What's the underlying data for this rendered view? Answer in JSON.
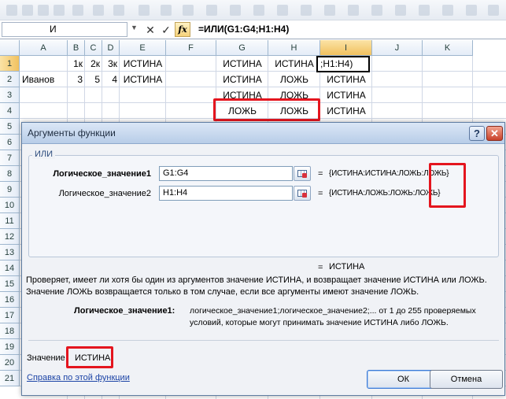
{
  "formula_bar": {
    "name_box": "И",
    "name_box_arrow": "▼",
    "cancel_glyph": "✕",
    "enter_glyph": "✓",
    "fx_label": "fx",
    "formula": "=ИЛИ(G1:G4;H1:H4)"
  },
  "grid": {
    "columns": [
      "A",
      "B",
      "C",
      "D",
      "E",
      "F",
      "G",
      "H",
      "I",
      "J",
      "K"
    ],
    "rows": [
      "1",
      "2",
      "3",
      "4",
      "5",
      "6",
      "7",
      "8",
      "9",
      "10",
      "11",
      "12",
      "13",
      "14",
      "15",
      "16",
      "17",
      "18",
      "19",
      "20",
      "21"
    ],
    "cells": {
      "B1": "1к",
      "C1": "2к",
      "D1": "3к",
      "E1": "ИСТИНА",
      "G1": "ИСТИНА",
      "H1": "ИСТИНА",
      "I1": ";H1:H4)",
      "A2": "Иванов",
      "B2": "3",
      "C2": "5",
      "D2": "4",
      "E2": "ИСТИНА",
      "G2": "ИСТИНА",
      "H2": "ЛОЖЬ",
      "I2": "ИСТИНА",
      "G3": "ИСТИНА",
      "H3": "ЛОЖЬ",
      "I3": "ИСТИНА",
      "G4": "ЛОЖЬ",
      "H4": "ЛОЖЬ",
      "I4": "ИСТИНА"
    }
  },
  "dialog": {
    "title": "Аргументы функции",
    "help_glyph": "?",
    "close_glyph": "✕",
    "function_name": "ИЛИ",
    "args": [
      {
        "label": "Логическое_значение1",
        "value": "G1:G4",
        "result": "{ИСТИНА:ИСТИНА:ЛОЖЬ:ЛОЖЬ}"
      },
      {
        "label": "Логическое_значение2",
        "value": "H1:H4",
        "result": "{ИСТИНА:ЛОЖЬ:ЛОЖЬ:ЛОЖЬ}"
      }
    ],
    "equals": "=",
    "result_line": "ИСТИНА",
    "description": [
      "Проверяет, имеет ли хотя бы один из аргументов значение ИСТИНА, и возвращает значение ИСТИНА или ЛОЖЬ.",
      "Значение ЛОЖЬ возвращается только в том случае, если все аргументы имеют значение ЛОЖЬ."
    ],
    "arg_help_label": "Логическое_значение1:",
    "arg_help_text": [
      "логическое_значение1;логическое_значение2;... от 1 до 255 проверяемых",
      "условий, которые могут принимать значение ИСТИНА либо ЛОЖЬ."
    ],
    "value_label": "Значение",
    "value": "ИСТИНА",
    "help_link": "Справка по этой функции",
    "ok_label": "ОК",
    "cancel_label": "Отмена"
  },
  "colors": {
    "highlight_red": "#e4151e",
    "selection_header": "#f1c15f",
    "dialog_title_bg": "#b8cde8"
  }
}
